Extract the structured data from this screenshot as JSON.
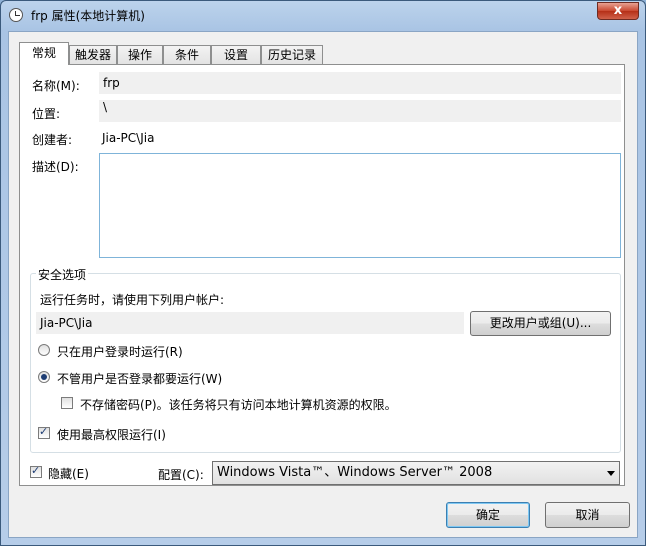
{
  "window": {
    "title": "frp 属性(本地计算机)",
    "close_label": "x"
  },
  "tabs": [
    {
      "label": "常规"
    },
    {
      "label": "触发器"
    },
    {
      "label": "操作"
    },
    {
      "label": "条件"
    },
    {
      "label": "设置"
    },
    {
      "label": "历史记录"
    }
  ],
  "general": {
    "name_label": "名称(M):",
    "name_value": "frp",
    "location_label": "位置:",
    "location_value": "\\",
    "author_label": "创建者:",
    "author_value": "Jia-PC\\Jia",
    "description_label": "描述(D):",
    "description_value": ""
  },
  "security": {
    "group_title": "安全选项",
    "run_as_label": "运行任务时，请使用下列用户帐户:",
    "user_account": "Jia-PC\\Jia",
    "change_user_button": "更改用户或组(U)...",
    "radio_logged_on": "只在用户登录时运行(R)",
    "radio_whether_logged_on": "不管用户是否登录都要运行(W)",
    "no_store_password": "不存储密码(P)。该任务将只有访问本地计算机资源的权限。",
    "highest_privileges": "使用最高权限运行(I)"
  },
  "bottom": {
    "hidden_label": "隐藏(E)",
    "config_label": "配置(C):",
    "config_value": "Windows Vista™、Windows Server™ 2008"
  },
  "buttons": {
    "ok": "确定",
    "cancel": "取消"
  }
}
